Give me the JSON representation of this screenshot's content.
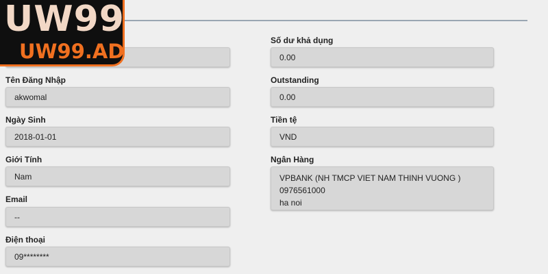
{
  "logo": {
    "main": "UW99",
    "sub": "UW99.AD"
  },
  "left": {
    "fields": [
      {
        "label": "",
        "value": ""
      },
      {
        "label": "Tên Đăng Nhập",
        "value": "akwomal"
      },
      {
        "label": "Ngày Sinh",
        "value": "2018-01-01"
      },
      {
        "label": "Giới Tính",
        "value": "Nam"
      },
      {
        "label": "Email",
        "value": "--"
      },
      {
        "label": "Điện thoại",
        "value": "09********"
      }
    ]
  },
  "right": {
    "balance": {
      "label": "Số dư khả dụng",
      "value": "0.00"
    },
    "outstanding": {
      "label": "Outstanding",
      "value": "0.00"
    },
    "currency": {
      "label": "Tiền tệ",
      "value": "VND"
    },
    "bank": {
      "label": "Ngân Hàng",
      "lines": [
        "VPBANK (NH TMCP VIET NAM THINH VUONG )",
        "0976561000",
        "ha noi"
      ]
    }
  },
  "colors": {
    "accent": "#f07020",
    "field_bg": "#d7d7d7",
    "page_bg": "#efefef"
  }
}
